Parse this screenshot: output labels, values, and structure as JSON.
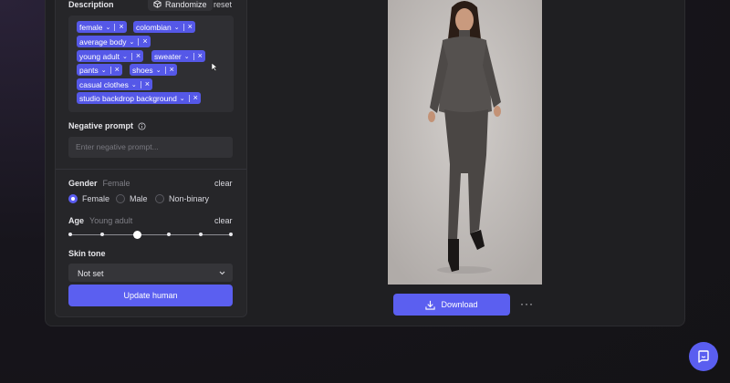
{
  "description": {
    "label": "Description",
    "randomize_label": "Randomize",
    "reset_label": "reset",
    "tags": [
      "female",
      "colombian",
      "average body",
      "young adult",
      "sweater",
      "pants",
      "shoes",
      "casual clothes",
      "studio backdrop background"
    ]
  },
  "negative_prompt": {
    "label": "Negative prompt",
    "placeholder": "Enter negative prompt..."
  },
  "gender": {
    "label": "Gender",
    "value": "Female",
    "clear_label": "clear",
    "options": [
      "Female",
      "Male",
      "Non-binary"
    ],
    "selected": "Female"
  },
  "age": {
    "label": "Age",
    "value": "Young adult",
    "clear_label": "clear",
    "steps": 6,
    "selected_step": 2
  },
  "skin_tone": {
    "label": "Skin tone",
    "value": "Not set"
  },
  "update_button_label": "Update human",
  "download_button_label": "Download",
  "more_label": "···",
  "colors": {
    "accent": "#5b5ff0",
    "panel": "#262629",
    "background": "#17151c"
  },
  "icons": [
    "cube-icon",
    "info-icon",
    "chevron-down-icon",
    "close-icon",
    "download-icon",
    "more-icon",
    "chat-icon"
  ]
}
